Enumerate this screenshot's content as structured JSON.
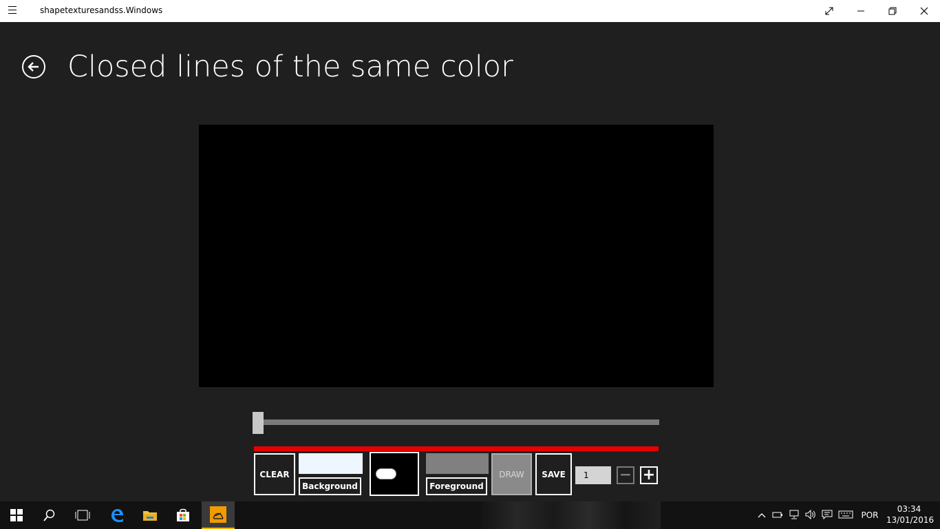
{
  "window": {
    "title": "shapetexturesandss.Windows"
  },
  "page": {
    "title": "Closed lines of the same color"
  },
  "toolbar": {
    "clear_label": "CLEAR",
    "background_label": "Background",
    "foreground_label": "Foreground",
    "draw_label": "DRAW",
    "save_label": "SAVE",
    "stepper_value": "1",
    "minus_label": "−",
    "plus_label": "+"
  },
  "slider": {
    "value": 0
  },
  "colors": {
    "background_swatch": "#eef7ff",
    "foreground_swatch": "#808080",
    "accent_bar": "#e60000",
    "canvas": "#000000"
  },
  "taskbar": {
    "icons": [
      "windows-start-icon",
      "search-icon",
      "task-view-icon",
      "edge-icon",
      "file-explorer-icon",
      "store-icon",
      "app-icon"
    ],
    "language": "POR",
    "time": "03:34",
    "date": "13/01/2016"
  }
}
